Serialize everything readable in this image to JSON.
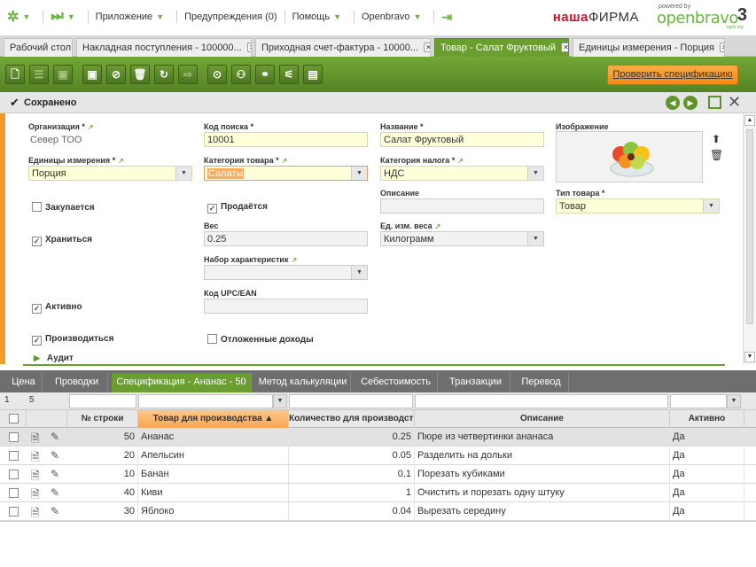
{
  "topnav": {
    "applications": "Приложение",
    "alerts": "Предупреждения (0)",
    "help": "Помощь",
    "user": "Openbravo",
    "brand_red": "наша",
    "brand_black": "ФИРМА",
    "powered_by": "powered by",
    "openbravo_logo": "openbravo",
    "logo_version": "3",
    "logo_tagline": "agile erp"
  },
  "tabs": [
    {
      "label": "Рабочий стол"
    },
    {
      "label": "Накладная поступления - 100000..."
    },
    {
      "label": "Приходная счет-фактура - 10000..."
    },
    {
      "label": "Товар - Салат Фруктовый"
    },
    {
      "label": "Единицы измерения - Порция"
    }
  ],
  "toolbar": {
    "verify_label": "Проверить спецификацию"
  },
  "status": {
    "message": "Сохранено"
  },
  "form": {
    "org_label": "Организация *",
    "org_value": "Север ТОО",
    "search_key_label": "Код поиска *",
    "search_key_value": "10001",
    "name_label": "Название *",
    "name_value": "Салат Фруктовый",
    "image_label": "Изображение",
    "uom_label": "Единицы измерения *",
    "uom_value": "Порция",
    "category_label": "Категория товара *",
    "category_value": "Салаты",
    "tax_label": "Категория налога *",
    "tax_value": "НДС",
    "description_label": "Описание",
    "description_value": "",
    "product_type_label": "Тип товара *",
    "product_type_value": "Товар",
    "purchased_label": "Закупается",
    "sold_label": "Продаётся",
    "weight_label": "Вес",
    "weight_value": "0.25",
    "weight_uom_label": "Ед. изм. веса",
    "weight_uom_value": "Килограмм",
    "stocked_label": "Храниться",
    "attribute_set_label": "Набор характеристик",
    "attribute_set_value": "",
    "upc_label": "Код UPC/EAN",
    "upc_value": "",
    "active_label": "Активно",
    "produced_label": "Производиться",
    "deferred_label": "Отложенные доходы",
    "audit_label": "Аудит"
  },
  "subtabs": [
    {
      "label": "Цена"
    },
    {
      "label": "Проводки"
    },
    {
      "label": "Спецификация - Ананас - 50"
    },
    {
      "label": "Метод калькуляции"
    },
    {
      "label": "Себестоимость"
    },
    {
      "label": "Транзакции"
    },
    {
      "label": "Перевод"
    }
  ],
  "grid": {
    "filter_page": "1",
    "filter_count": "5",
    "columns": {
      "line_no": "№ строки",
      "product": "Товар для производства",
      "quantity": "Количество для производства",
      "description": "Описание",
      "active": "Активно"
    },
    "rows": [
      {
        "line": "50",
        "product": "Ананас",
        "qty": "0.25",
        "desc": "Пюре из четвертинки ананаса",
        "active": "Да"
      },
      {
        "line": "20",
        "product": "Апельсин",
        "qty": "0.05",
        "desc": "Разделить на дольки",
        "active": "Да"
      },
      {
        "line": "10",
        "product": "Банан",
        "qty": "0.1",
        "desc": "Порезать кубиками",
        "active": "Да"
      },
      {
        "line": "40",
        "product": "Киви",
        "qty": "1",
        "desc": "Очистить и порезать одну штуку",
        "active": "Да"
      },
      {
        "line": "30",
        "product": "Яблоко",
        "qty": "0.04",
        "desc": "Вырезать середину",
        "active": "Да"
      }
    ]
  }
}
